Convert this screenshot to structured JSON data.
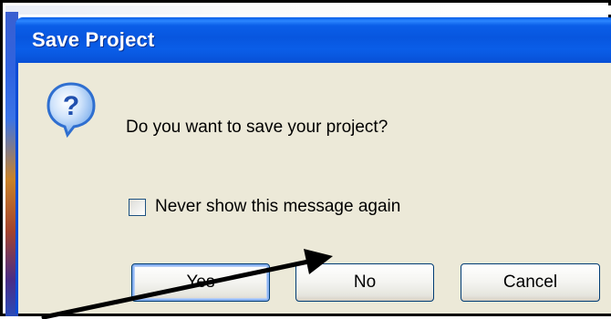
{
  "dialog": {
    "title": "Save Project",
    "message": "Do you want to save your project?",
    "icon": "question-icon",
    "checkbox": {
      "label": "Never show this message again",
      "checked": false
    },
    "buttons": {
      "yes": "Yes",
      "no": "No",
      "cancel": "Cancel"
    }
  },
  "colors": {
    "titlebar": "#0a5ee8",
    "dialog_bg": "#ece9d8",
    "icon_blue": "#2f7fe0",
    "annotation_arrow": "#000000"
  }
}
